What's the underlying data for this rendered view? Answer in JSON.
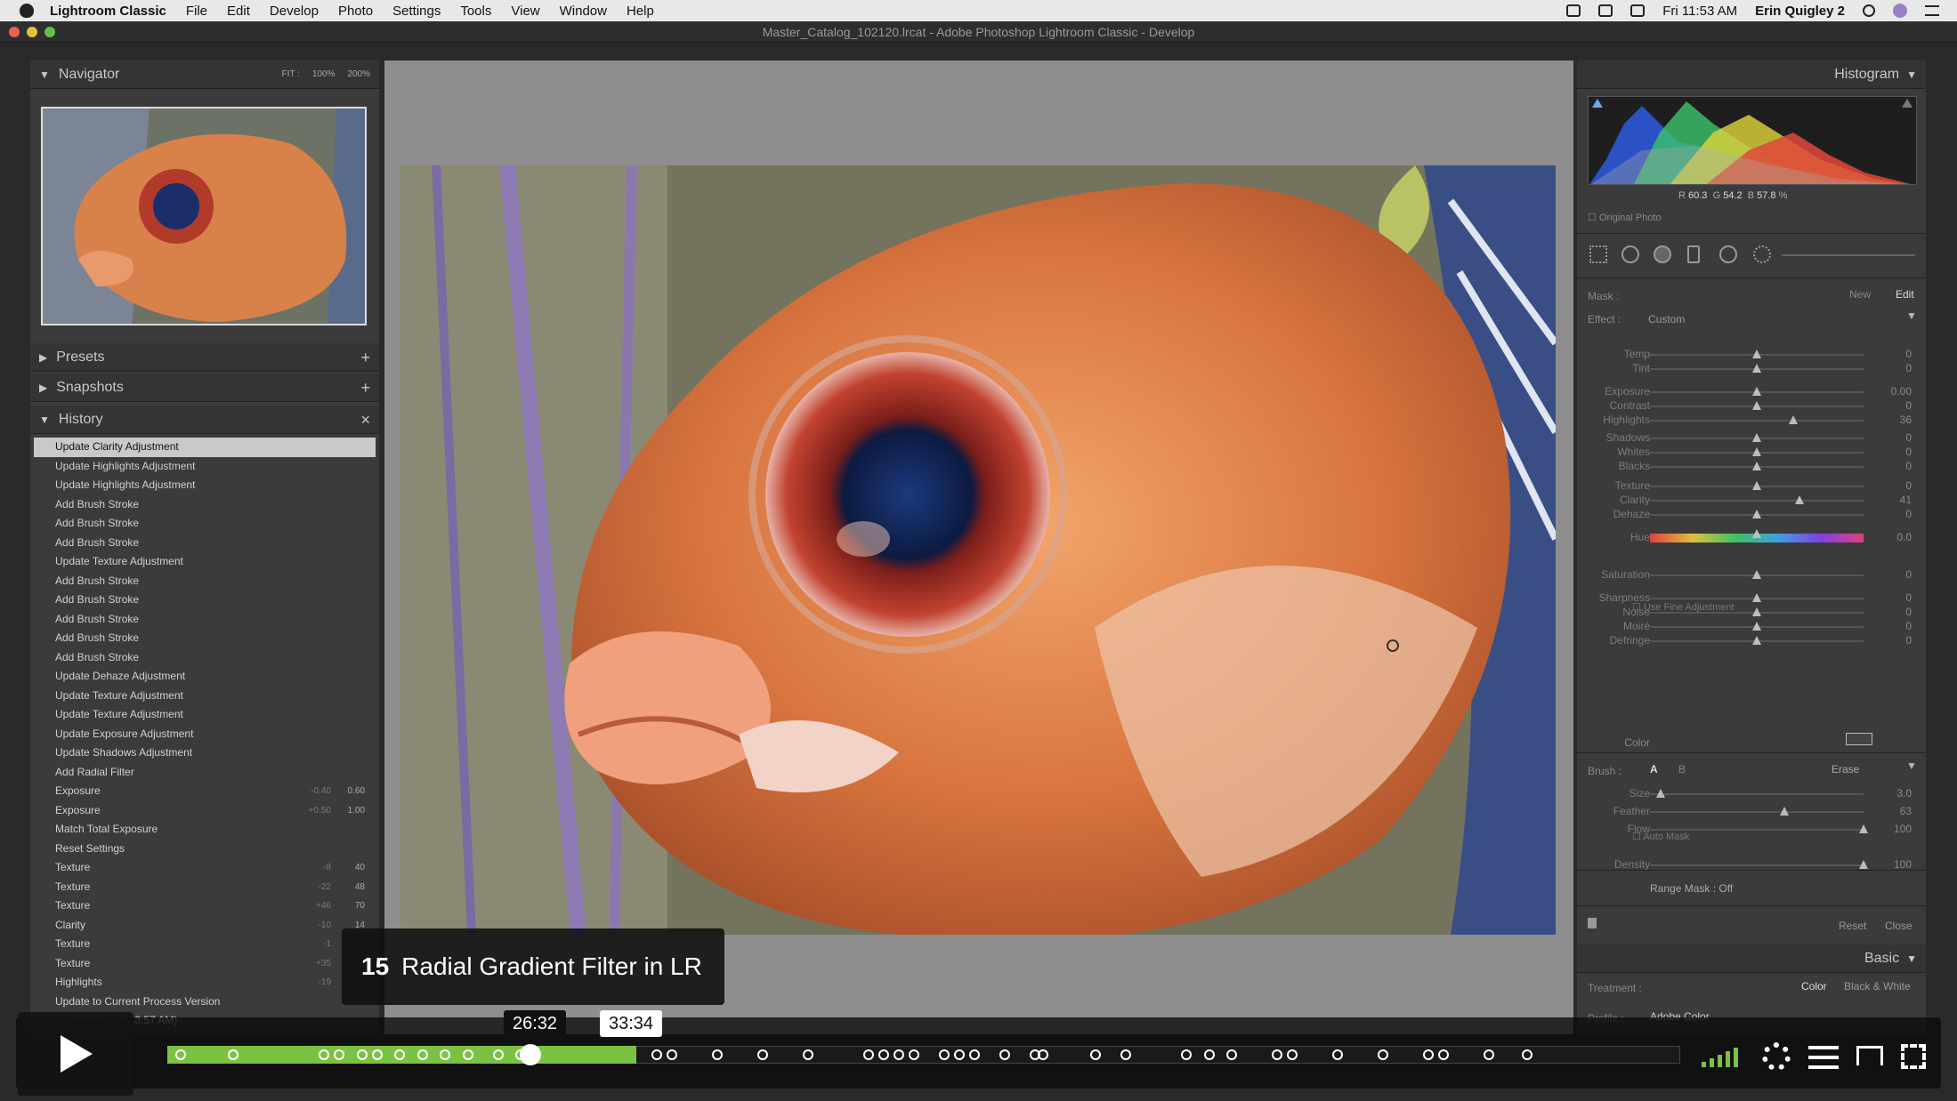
{
  "menubar": {
    "app": "Lightroom Classic",
    "items": [
      "File",
      "Edit",
      "Develop",
      "Photo",
      "Settings",
      "Tools",
      "View",
      "Window",
      "Help"
    ],
    "clock": "Fri 11:53 AM",
    "user": "Erin Quigley 2"
  },
  "window": {
    "title": "Master_Catalog_102120.lrcat - Adobe Photoshop Lightroom Classic - Develop"
  },
  "navigator": {
    "title": "Navigator",
    "zoom": [
      "FIT :",
      "100%",
      "200%"
    ]
  },
  "panels": {
    "presets": "Presets",
    "snapshots": "Snapshots",
    "history": "History"
  },
  "history": [
    {
      "label": "Update Clarity Adjustment",
      "selected": true
    },
    {
      "label": "Update Highlights Adjustment"
    },
    {
      "label": "Update Highlights Adjustment"
    },
    {
      "label": "Add Brush Stroke"
    },
    {
      "label": "Add Brush Stroke"
    },
    {
      "label": "Add Brush Stroke"
    },
    {
      "label": "Update Texture Adjustment"
    },
    {
      "label": "Add Brush Stroke"
    },
    {
      "label": "Add Brush Stroke"
    },
    {
      "label": "Add Brush Stroke"
    },
    {
      "label": "Add Brush Stroke"
    },
    {
      "label": "Add Brush Stroke"
    },
    {
      "label": "Update Dehaze Adjustment"
    },
    {
      "label": "Update Texture Adjustment"
    },
    {
      "label": "Update Texture Adjustment"
    },
    {
      "label": "Update Exposure Adjustment"
    },
    {
      "label": "Update Shadows Adjustment"
    },
    {
      "label": "Add Radial Filter"
    },
    {
      "label": "Exposure",
      "v1": "-0.40",
      "v2": "0.60"
    },
    {
      "label": "Exposure",
      "v1": "+0.50",
      "v2": "1.00"
    },
    {
      "label": "Match Total Exposure"
    },
    {
      "label": "Reset Settings"
    },
    {
      "label": "Texture",
      "v1": "-8",
      "v2": "40"
    },
    {
      "label": "Texture",
      "v1": "-22",
      "v2": "48"
    },
    {
      "label": "Texture",
      "v1": "+46",
      "v2": "70"
    },
    {
      "label": "Clarity",
      "v1": "-10",
      "v2": "14"
    },
    {
      "label": "Texture",
      "v1": "-1",
      "v2": ""
    },
    {
      "label": "Texture",
      "v1": "+35",
      "v2": ""
    },
    {
      "label": "Highlights",
      "v1": "-19",
      "v2": ""
    },
    {
      "label": "Update to Current Process Version"
    },
    {
      "label": "ive (4/30/14 12:43:57 AM)"
    }
  ],
  "histogram": {
    "title": "Histogram",
    "r_label": "R",
    "r": "60.3",
    "g_label": "G",
    "g": "54.2",
    "b_label": "B",
    "b": "57.8",
    "pct": "%",
    "original_photo": "Original Photo"
  },
  "mask": {
    "label": "Mask :",
    "new": "New",
    "edit": "Edit",
    "effect_label": "Effect :",
    "effect_value": "Custom"
  },
  "sliders": [
    {
      "label": "Temp",
      "value": "0",
      "pos": 0.5
    },
    {
      "label": "Tint",
      "value": "0",
      "pos": 0.5
    },
    {
      "label": "Exposure",
      "value": "0.00",
      "pos": 0.5
    },
    {
      "label": "Contrast",
      "value": "0",
      "pos": 0.5
    },
    {
      "label": "Highlights",
      "value": "36",
      "pos": 0.67
    },
    {
      "label": "Shadows",
      "value": "0",
      "pos": 0.5
    },
    {
      "label": "Whites",
      "value": "0",
      "pos": 0.5
    },
    {
      "label": "Blacks",
      "value": "0",
      "pos": 0.5
    },
    {
      "label": "Texture",
      "value": "0",
      "pos": 0.5
    },
    {
      "label": "Clarity",
      "value": "41",
      "pos": 0.7
    },
    {
      "label": "Dehaze",
      "value": "0",
      "pos": 0.5
    },
    {
      "label": "Hue",
      "value": "0.0",
      "pos": 0.5
    },
    {
      "label": "Saturation",
      "value": "0",
      "pos": 0.5
    },
    {
      "label": "Sharpness",
      "value": "0",
      "pos": 0.5
    },
    {
      "label": "Noise",
      "value": "0",
      "pos": 0.5
    },
    {
      "label": "Moiré",
      "value": "0",
      "pos": 0.5
    },
    {
      "label": "Defringe",
      "value": "0",
      "pos": 0.5
    }
  ],
  "fine_adjustment": "Use Fine Adjustment",
  "color_label": "Color",
  "brush": {
    "label": "Brush :",
    "a": "A",
    "b": "B",
    "erase": "Erase",
    "rows": [
      {
        "label": "Size",
        "value": "3.0",
        "pos": 0.05
      },
      {
        "label": "Feather",
        "value": "63",
        "pos": 0.63
      },
      {
        "label": "Flow",
        "value": "100",
        "pos": 1.0
      }
    ],
    "auto_mask": "Auto Mask",
    "density": {
      "label": "Density",
      "value": "100",
      "pos": 1.0
    }
  },
  "range_mask": "Range Mask : Off",
  "reset": "Reset",
  "close": "Close",
  "basic": {
    "title": "Basic",
    "treatment_label": "Treatment :",
    "color": "Color",
    "bw": "Black & White",
    "profile_label": "Profile :",
    "profile_value": "Adobe Color"
  },
  "video": {
    "chapter_number": "15",
    "chapter_title": "Radial Gradient Filter in LR",
    "hover_time": "26:32",
    "current_time": "33:34",
    "progress": 0.31
  }
}
